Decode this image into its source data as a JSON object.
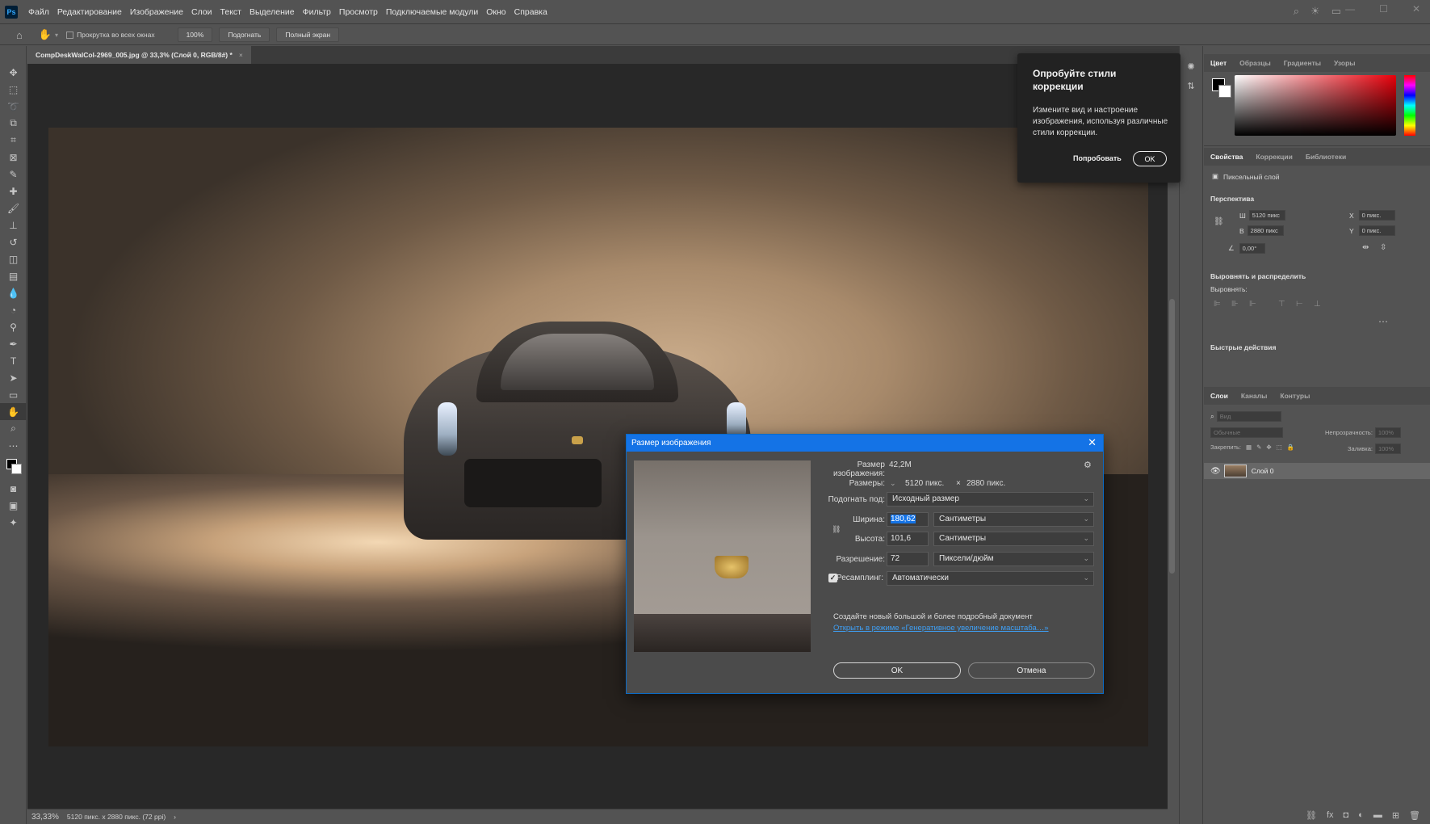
{
  "app": {
    "logo": "Ps",
    "menu": [
      "Файл",
      "Редактирование",
      "Изображение",
      "Слои",
      "Текст",
      "Выделение",
      "Фильтр",
      "Просмотр",
      "Подключаемые модули",
      "Окно",
      "Справка"
    ],
    "window_controls": [
      "minimize-icon",
      "maximize-icon",
      "close-icon"
    ]
  },
  "options_bar": {
    "scroll_all_label": "Прокрутка во всех окнах",
    "zoom_100": "100%",
    "fit": "Подогнать",
    "full_screen": "Полный экран"
  },
  "document": {
    "tab_title": "CompDeskWalCol-2969_005.jpg @ 33,3% (Слой 0, RGB/8#) *",
    "close": "×"
  },
  "status": {
    "zoom": "33,33%",
    "info": "5120 пикс. x 2880 пикс. (72 ppi)",
    "arrow": "›"
  },
  "tooltip": {
    "title": "Опробуйте стили коррекции",
    "body": "Измените вид и настроение изображения, используя различные стили коррекции.",
    "try_label": "Попробовать",
    "ok_label": "OK"
  },
  "color_panel": {
    "tabs": [
      "Цвет",
      "Образцы",
      "Градиенты",
      "Узоры"
    ]
  },
  "properties_panel": {
    "tabs": [
      "Свойства",
      "Коррекции",
      "Библиотеки"
    ],
    "layer_type": "Пиксельный слой",
    "perspective_title": "Перспектива",
    "w_label": "Ш",
    "w_value": "5120 пикс",
    "h_label": "В",
    "h_value": "2880 пикс",
    "x_label": "X",
    "x_value": "0 пикс.",
    "y_label": "Y",
    "y_value": "0 пикс.",
    "angle_value": "0,00°",
    "align_title": "Выровнять и распределить",
    "align_label": "Выровнять:",
    "quick_actions_title": "Быстрые действия"
  },
  "layers_panel": {
    "tabs": [
      "Слои",
      "Каналы",
      "Контуры"
    ],
    "search_placeholder": "Вид",
    "blend_mode": "Обычные",
    "opacity_label": "Непрозрачность:",
    "opacity_value": "100%",
    "lock_label": "Закрепить:",
    "fill_label": "Заливка:",
    "fill_value": "100%",
    "layer_name": "Слой 0"
  },
  "dialog": {
    "title": "Размер изображения",
    "size_label": "Размер изображения:",
    "size_value": "42,2M",
    "dims_label": "Размеры:",
    "dims_w": "5120 пикс.",
    "dims_x": "×",
    "dims_h": "2880 пикс.",
    "fit_label": "Подогнать под:",
    "fit_value": "Исходный размер",
    "width_label": "Ширина:",
    "width_value": "180,62",
    "width_unit": "Сантиметры",
    "height_label": "Высота:",
    "height_value": "101,6",
    "height_unit": "Сантиметры",
    "res_label": "Разрешение:",
    "res_value": "72",
    "res_unit": "Пиксели/дюйм",
    "resample_label": "Ресамплинг:",
    "resample_value": "Автоматически",
    "hint": "Создайте новый большой и более подробный документ",
    "link": "Открыть в режиме «Генеративное увеличение масштаба…»",
    "ok": "OK",
    "cancel": "Отмена"
  }
}
